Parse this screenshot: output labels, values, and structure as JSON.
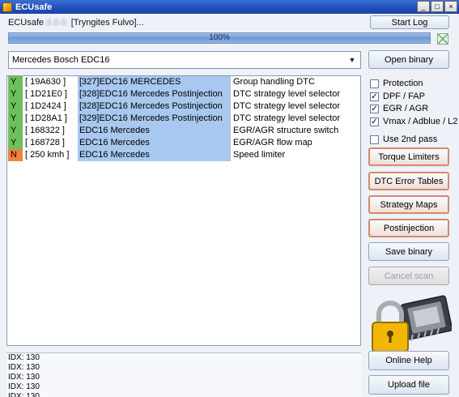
{
  "window": {
    "title": "ECUsafe",
    "controls": [
      "_",
      "□",
      "×"
    ]
  },
  "header": {
    "app_name": "ECUsafe",
    "version": "3.0.0",
    "user": "[Tryngites Fulvo]..."
  },
  "progress": {
    "value": 1.0,
    "text": "100%"
  },
  "ecu_select": {
    "value": "Mercedes Bosch EDC16"
  },
  "buttons": {
    "start_log": "Start Log",
    "open_binary": "Open binary",
    "torque_limiters": "Torque Limiters",
    "dtc_error_tables": "DTC Error Tables",
    "strategy_maps": "Strategy Maps",
    "postinjection": "Postinjection",
    "save_binary": "Save binary",
    "cancel_scan": "Cancel scan",
    "online_help": "Online Help",
    "upload_file": "Upload file"
  },
  "options": [
    {
      "label": "Protection",
      "checked": false
    },
    {
      "label": "DPF / FAP",
      "checked": true
    },
    {
      "label": "EGR / AGR",
      "checked": true
    },
    {
      "label": "Vmax / Adblue / L2",
      "checked": true
    },
    {
      "label": "Use 2nd pass",
      "checked": false
    }
  ],
  "results": [
    {
      "status": "Y",
      "addr": "[ 19A630 ]",
      "name": "[327]EDC16 MERCEDES",
      "desc": "Group handling DTC",
      "color": "#6fbf5a"
    },
    {
      "status": "Y",
      "addr": "[ 1D21E0 ]",
      "name": "[328]EDC16 Mercedes Postinjection",
      "desc": "DTC strategy level selector",
      "color": "#6fbf5a"
    },
    {
      "status": "Y",
      "addr": "[ 1D2424 ]",
      "name": "[328]EDC16 Mercedes Postinjection",
      "desc": "DTC strategy level selector",
      "color": "#6fbf5a"
    },
    {
      "status": "Y",
      "addr": "[ 1D28A1 ]",
      "name": "[329]EDC16 Mercedes Postinjection",
      "desc": "DTC strategy level selector",
      "color": "#6fbf5a"
    },
    {
      "status": "Y",
      "addr": "[ 168322 ]",
      "name": "EDC16 Mercedes",
      "desc": "EGR/AGR structure switch",
      "color": "#6fbf5a"
    },
    {
      "status": "Y",
      "addr": "[ 168728 ]",
      "name": "EDC16 Mercedes",
      "desc": "EGR/AGR flow map",
      "color": "#6fbf5a"
    },
    {
      "status": "N",
      "addr": "[ 250 kmh ]",
      "name": "EDC16 Mercedes",
      "desc": "Speed limiter",
      "color": "#f08040"
    }
  ],
  "log": [
    "IDX: 130",
    "IDX: 130",
    "IDX: 130",
    "IDX: 130",
    "IDX: 130"
  ],
  "colors": {
    "titlebar": "#2457c5",
    "selection": "#a8c8f0",
    "accent_border": "#d48a6c"
  }
}
